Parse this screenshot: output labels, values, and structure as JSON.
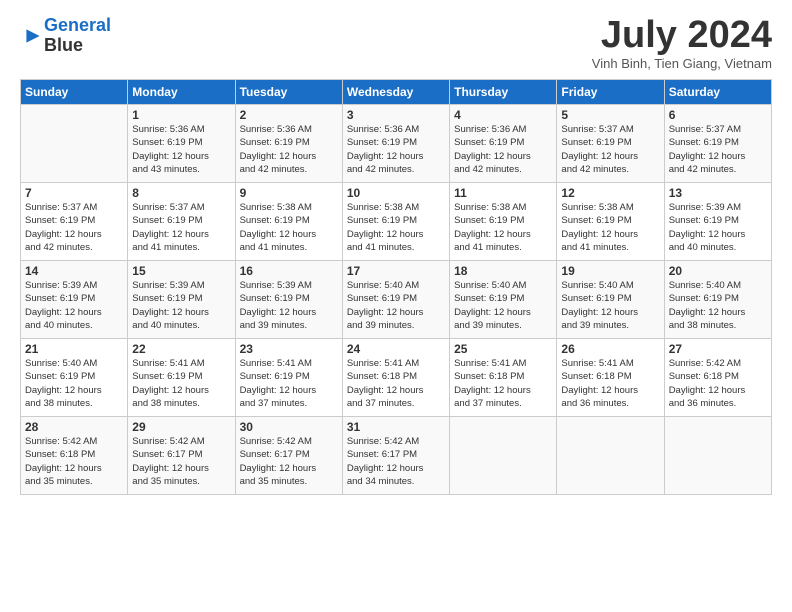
{
  "logo": {
    "line1": "General",
    "line2": "Blue"
  },
  "title": "July 2024",
  "location": "Vinh Binh, Tien Giang, Vietnam",
  "days_header": [
    "Sunday",
    "Monday",
    "Tuesday",
    "Wednesday",
    "Thursday",
    "Friday",
    "Saturday"
  ],
  "weeks": [
    [
      {
        "day": "",
        "info": ""
      },
      {
        "day": "1",
        "info": "Sunrise: 5:36 AM\nSunset: 6:19 PM\nDaylight: 12 hours\nand 43 minutes."
      },
      {
        "day": "2",
        "info": "Sunrise: 5:36 AM\nSunset: 6:19 PM\nDaylight: 12 hours\nand 42 minutes."
      },
      {
        "day": "3",
        "info": "Sunrise: 5:36 AM\nSunset: 6:19 PM\nDaylight: 12 hours\nand 42 minutes."
      },
      {
        "day": "4",
        "info": "Sunrise: 5:36 AM\nSunset: 6:19 PM\nDaylight: 12 hours\nand 42 minutes."
      },
      {
        "day": "5",
        "info": "Sunrise: 5:37 AM\nSunset: 6:19 PM\nDaylight: 12 hours\nand 42 minutes."
      },
      {
        "day": "6",
        "info": "Sunrise: 5:37 AM\nSunset: 6:19 PM\nDaylight: 12 hours\nand 42 minutes."
      }
    ],
    [
      {
        "day": "7",
        "info": "Sunrise: 5:37 AM\nSunset: 6:19 PM\nDaylight: 12 hours\nand 42 minutes."
      },
      {
        "day": "8",
        "info": "Sunrise: 5:37 AM\nSunset: 6:19 PM\nDaylight: 12 hours\nand 41 minutes."
      },
      {
        "day": "9",
        "info": "Sunrise: 5:38 AM\nSunset: 6:19 PM\nDaylight: 12 hours\nand 41 minutes."
      },
      {
        "day": "10",
        "info": "Sunrise: 5:38 AM\nSunset: 6:19 PM\nDaylight: 12 hours\nand 41 minutes."
      },
      {
        "day": "11",
        "info": "Sunrise: 5:38 AM\nSunset: 6:19 PM\nDaylight: 12 hours\nand 41 minutes."
      },
      {
        "day": "12",
        "info": "Sunrise: 5:38 AM\nSunset: 6:19 PM\nDaylight: 12 hours\nand 41 minutes."
      },
      {
        "day": "13",
        "info": "Sunrise: 5:39 AM\nSunset: 6:19 PM\nDaylight: 12 hours\nand 40 minutes."
      }
    ],
    [
      {
        "day": "14",
        "info": "Sunrise: 5:39 AM\nSunset: 6:19 PM\nDaylight: 12 hours\nand 40 minutes."
      },
      {
        "day": "15",
        "info": "Sunrise: 5:39 AM\nSunset: 6:19 PM\nDaylight: 12 hours\nand 40 minutes."
      },
      {
        "day": "16",
        "info": "Sunrise: 5:39 AM\nSunset: 6:19 PM\nDaylight: 12 hours\nand 39 minutes."
      },
      {
        "day": "17",
        "info": "Sunrise: 5:40 AM\nSunset: 6:19 PM\nDaylight: 12 hours\nand 39 minutes."
      },
      {
        "day": "18",
        "info": "Sunrise: 5:40 AM\nSunset: 6:19 PM\nDaylight: 12 hours\nand 39 minutes."
      },
      {
        "day": "19",
        "info": "Sunrise: 5:40 AM\nSunset: 6:19 PM\nDaylight: 12 hours\nand 39 minutes."
      },
      {
        "day": "20",
        "info": "Sunrise: 5:40 AM\nSunset: 6:19 PM\nDaylight: 12 hours\nand 38 minutes."
      }
    ],
    [
      {
        "day": "21",
        "info": "Sunrise: 5:40 AM\nSunset: 6:19 PM\nDaylight: 12 hours\nand 38 minutes."
      },
      {
        "day": "22",
        "info": "Sunrise: 5:41 AM\nSunset: 6:19 PM\nDaylight: 12 hours\nand 38 minutes."
      },
      {
        "day": "23",
        "info": "Sunrise: 5:41 AM\nSunset: 6:19 PM\nDaylight: 12 hours\nand 37 minutes."
      },
      {
        "day": "24",
        "info": "Sunrise: 5:41 AM\nSunset: 6:18 PM\nDaylight: 12 hours\nand 37 minutes."
      },
      {
        "day": "25",
        "info": "Sunrise: 5:41 AM\nSunset: 6:18 PM\nDaylight: 12 hours\nand 37 minutes."
      },
      {
        "day": "26",
        "info": "Sunrise: 5:41 AM\nSunset: 6:18 PM\nDaylight: 12 hours\nand 36 minutes."
      },
      {
        "day": "27",
        "info": "Sunrise: 5:42 AM\nSunset: 6:18 PM\nDaylight: 12 hours\nand 36 minutes."
      }
    ],
    [
      {
        "day": "28",
        "info": "Sunrise: 5:42 AM\nSunset: 6:18 PM\nDaylight: 12 hours\nand 35 minutes."
      },
      {
        "day": "29",
        "info": "Sunrise: 5:42 AM\nSunset: 6:17 PM\nDaylight: 12 hours\nand 35 minutes."
      },
      {
        "day": "30",
        "info": "Sunrise: 5:42 AM\nSunset: 6:17 PM\nDaylight: 12 hours\nand 35 minutes."
      },
      {
        "day": "31",
        "info": "Sunrise: 5:42 AM\nSunset: 6:17 PM\nDaylight: 12 hours\nand 34 minutes."
      },
      {
        "day": "",
        "info": ""
      },
      {
        "day": "",
        "info": ""
      },
      {
        "day": "",
        "info": ""
      }
    ]
  ]
}
